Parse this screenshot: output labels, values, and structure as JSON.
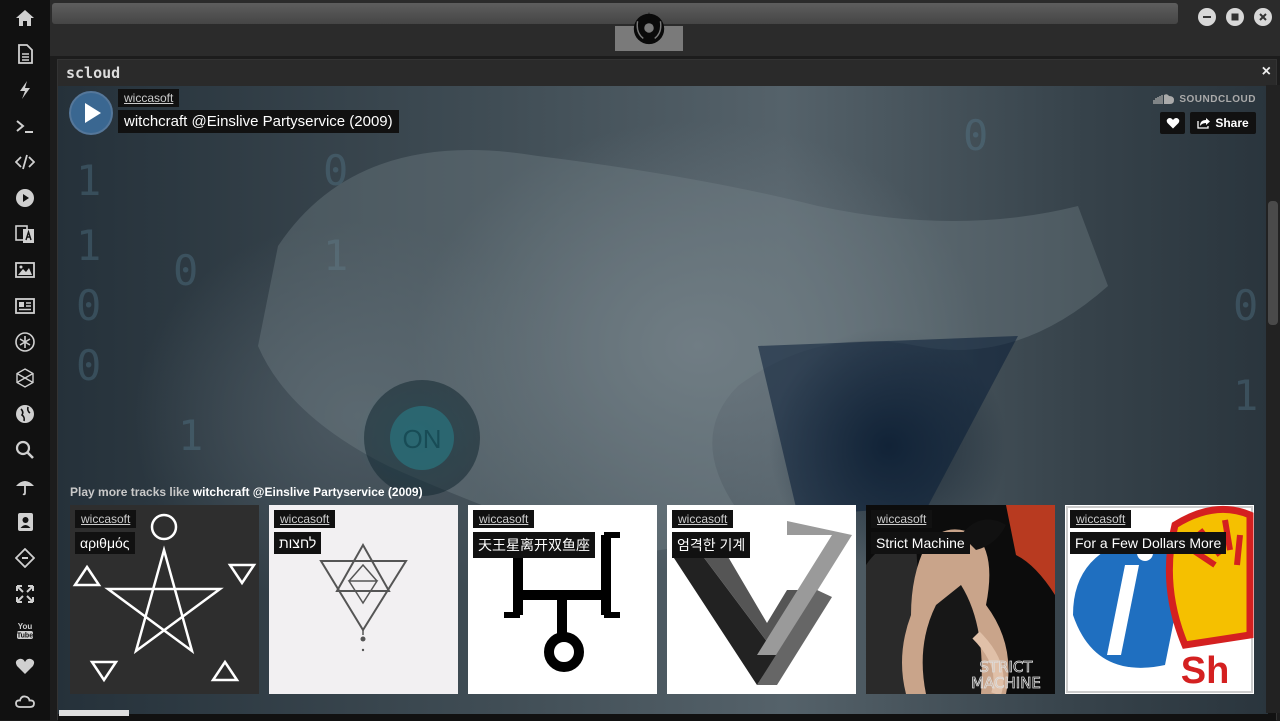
{
  "window": {
    "panel_title": "scloud",
    "close_glyph": "×"
  },
  "sidebar": {
    "icons": [
      "home-icon",
      "document-icon",
      "bolt-icon",
      "terminal-icon",
      "code-icon",
      "play-circle-icon",
      "translate-icon",
      "image-icon",
      "newspaper-icon",
      "snowflake-icon",
      "hexagon-icon",
      "globe-icon",
      "search-icon",
      "umbrella-icon",
      "contacts-icon",
      "git-icon",
      "expand-icon",
      "youtube-icon",
      "heart-icon",
      "cloud-icon"
    ]
  },
  "player": {
    "user": "wiccasoft",
    "title": "witchcraft @Einslive Partyservice (2009)",
    "brand": "SOUNDCLOUD",
    "share_label": "Share",
    "more_prefix": "Play more tracks like",
    "more_track": "witchcraft @Einslive Partyservice (2009)"
  },
  "tracks": [
    {
      "user": "wiccasoft",
      "title": "αριθμός"
    },
    {
      "user": "wiccasoft",
      "title": "לחצות"
    },
    {
      "user": "wiccasoft",
      "title": "天王星离开双鱼座"
    },
    {
      "user": "wiccasoft",
      "title": "엄격한 기계"
    },
    {
      "user": "wiccasoft",
      "title": "Strict Machine"
    },
    {
      "user": "wiccasoft",
      "title": "For a Few Dollars More"
    }
  ],
  "colors": {
    "play_button": "#3a6791",
    "sidebar_bg": "#111111",
    "icon": "#d0d0d0"
  }
}
